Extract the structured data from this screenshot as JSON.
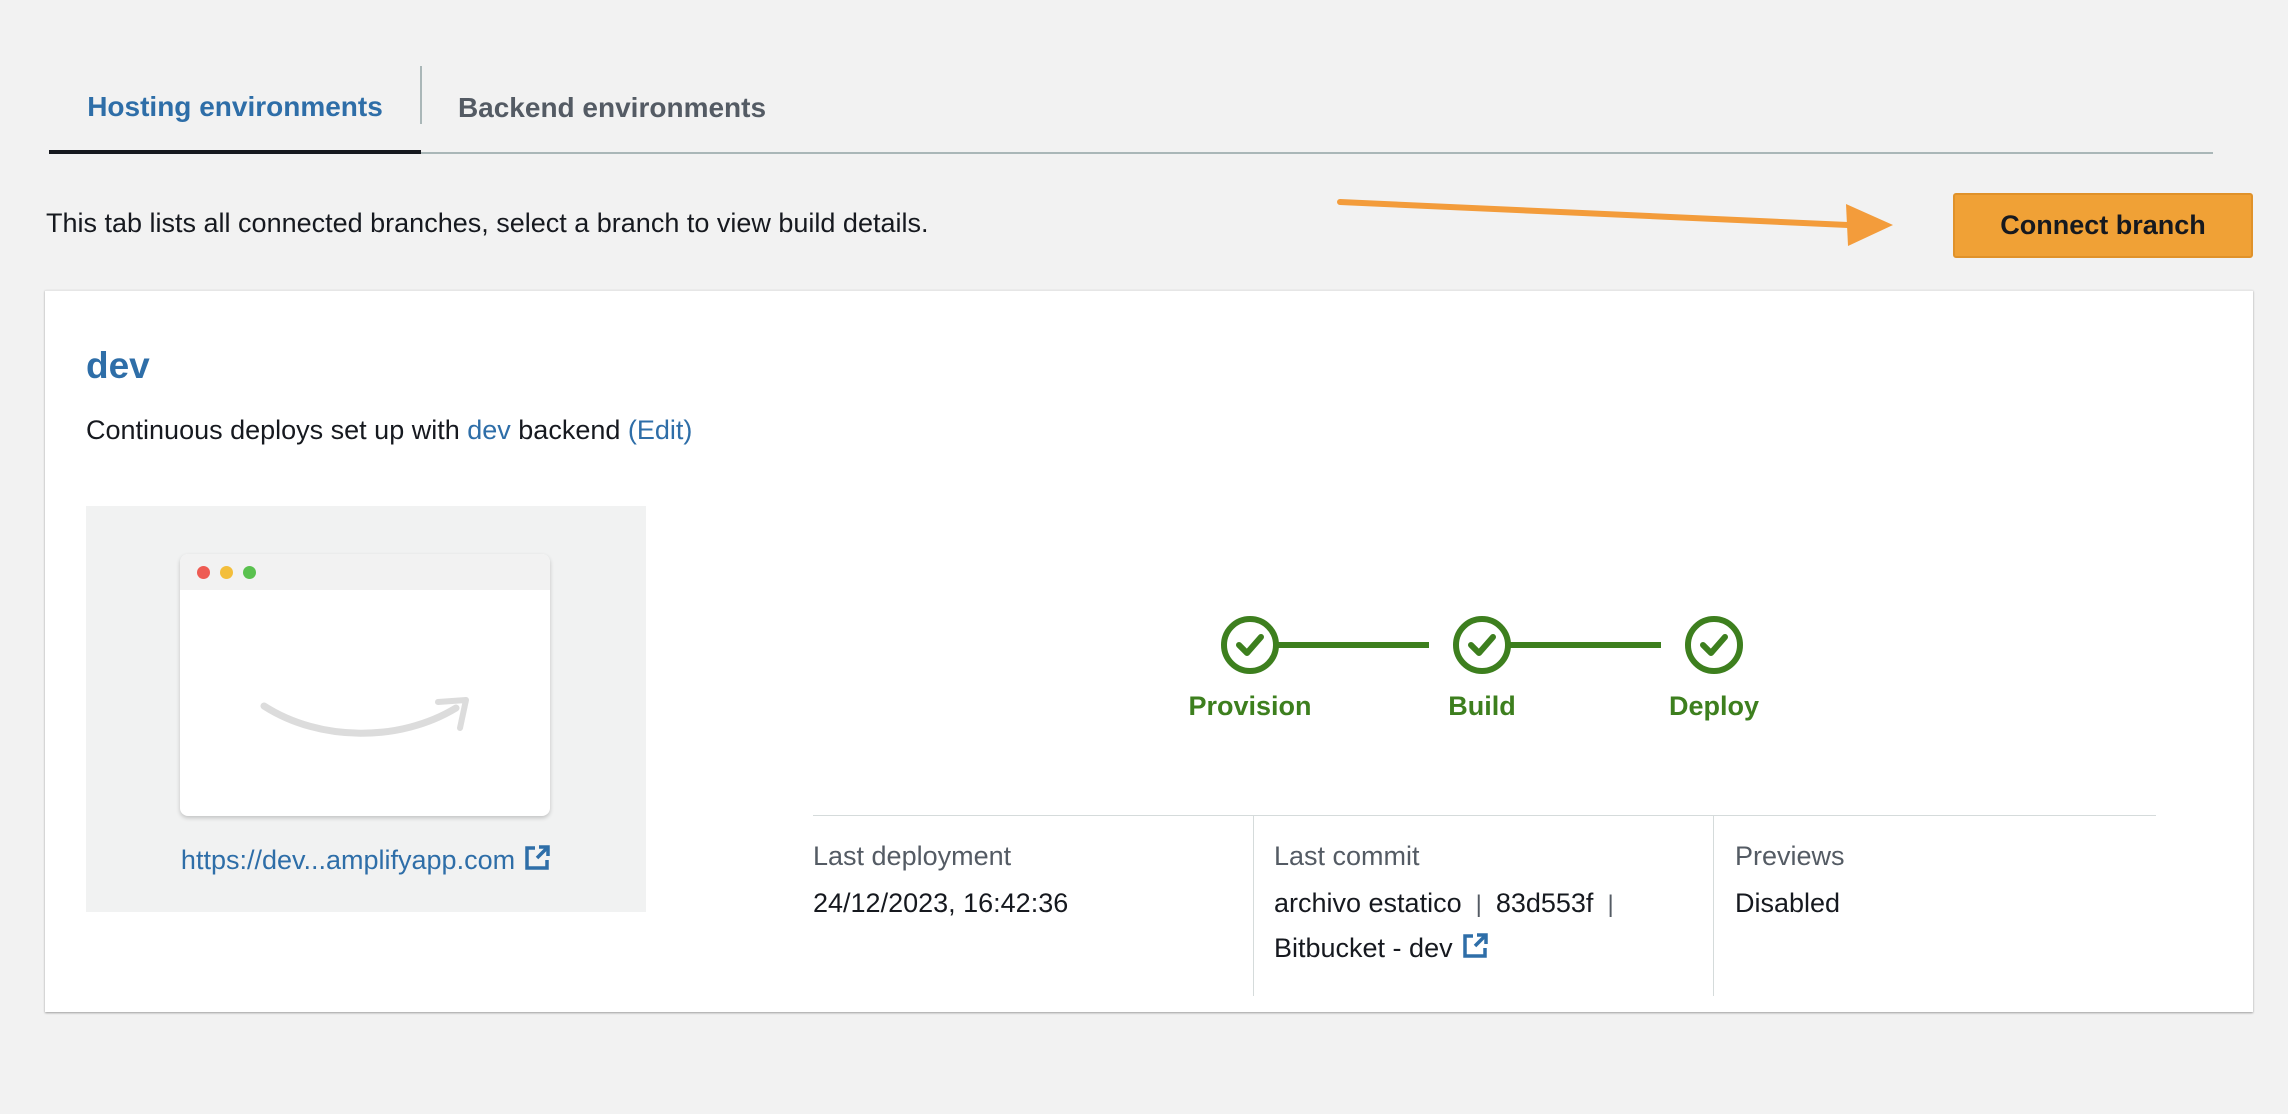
{
  "tabs": {
    "hosting_label": "Hosting environments",
    "backend_label": "Backend environments"
  },
  "description": "This tab lists all connected branches, select a branch to view build details.",
  "connect_button_label": "Connect branch",
  "branch": {
    "name": "dev",
    "deploy_prefix": "Continuous deploys set up with ",
    "backend_link": "dev",
    "deploy_middle": " backend ",
    "edit_link": "(Edit)",
    "app_url": "https://dev...amplifyapp.com"
  },
  "steps": [
    {
      "label": "Provision",
      "status": "complete"
    },
    {
      "label": "Build",
      "status": "complete"
    },
    {
      "label": "Deploy",
      "status": "complete"
    }
  ],
  "info": {
    "last_deployment_label": "Last deployment",
    "last_deployment_value": "24/12/2023, 16:42:36",
    "last_commit_label": "Last commit",
    "commit_message": "archivo estatico",
    "commit_separator": "|",
    "commit_hash": "83d553f",
    "repo_link": "Bitbucket - dev",
    "previews_label": "Previews",
    "previews_value": "Disabled"
  },
  "colors": {
    "accent_blue": "#2e6ea8",
    "primary_button": "#f0a136",
    "success_green": "#3d7f1e",
    "annotation_arrow": "#f39c3b"
  },
  "icons": [
    "external-link-icon",
    "check-icon",
    "amazon-smile-logo",
    "annotation-arrow"
  ]
}
